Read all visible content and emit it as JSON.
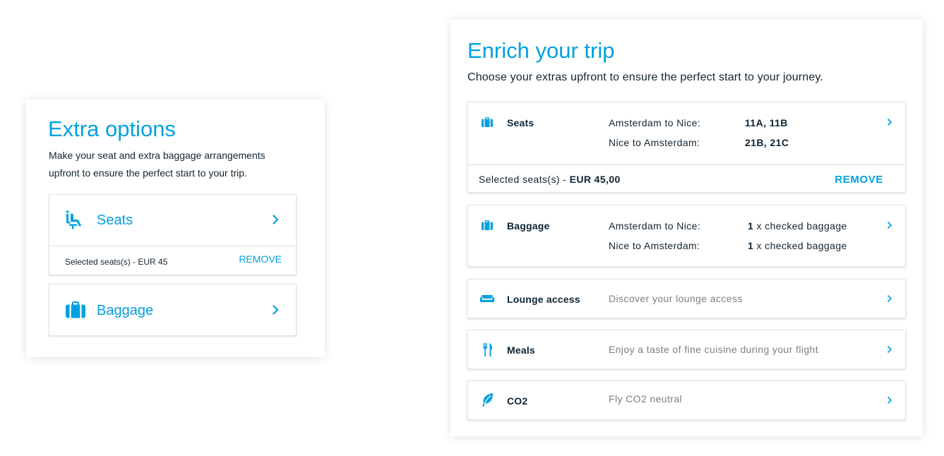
{
  "colors": {
    "accent": "#00a1de",
    "text": "#15242f",
    "muted": "#7a7f84",
    "border": "#dde4e9"
  },
  "left_panel": {
    "title": "Extra options",
    "description": "Make your seat and extra baggage arrangements upfront to ensure the perfect start to your trip.",
    "seats": {
      "icon": "seat-icon",
      "label": "Seats",
      "selected_text": "Selected seats(s) - EUR 45",
      "remove_label": "REMOVE",
      "chevron": "chevron-right-icon"
    },
    "baggage": {
      "icon": "suitcase-icon",
      "label": "Baggage",
      "chevron": "chevron-right-icon"
    }
  },
  "right_panel": {
    "title": "Enrich your trip",
    "subtitle": "Choose your extras upfront to ensure the perfect start to your journey.",
    "seats": {
      "icon": "suitcase-icon",
      "label": "Seats",
      "rows": [
        {
          "route": "Amsterdam to Nice:",
          "value": "11A, 11B"
        },
        {
          "route": "Nice to Amsterdam:",
          "value": "21B, 21C"
        }
      ],
      "selected_prefix": "Selected seats(s) - ",
      "selected_amount": "EUR 45,00",
      "remove_label": "REMOVE",
      "chevron": "chevron-right-icon"
    },
    "baggage": {
      "icon": "suitcase-icon",
      "label": "Baggage",
      "rows": [
        {
          "route": "Amsterdam to Nice:",
          "count": "1",
          "unit": " x checked baggage"
        },
        {
          "route": "Nice to Amsterdam:",
          "count": "1",
          "unit": " x checked baggage"
        }
      ],
      "chevron": "chevron-right-icon"
    },
    "lounge": {
      "icon": "sofa-icon",
      "label": "Lounge access",
      "description": "Discover your lounge access",
      "chevron": "chevron-right-icon"
    },
    "meals": {
      "icon": "fork-knife-icon",
      "label": "Meals",
      "description": "Enjoy a taste of fine cuisine during your flight",
      "chevron": "chevron-right-icon"
    },
    "co2": {
      "icon": "leaf-icon",
      "label": "CO2",
      "description": "Fly CO2 neutral",
      "chevron": "chevron-right-icon"
    }
  }
}
